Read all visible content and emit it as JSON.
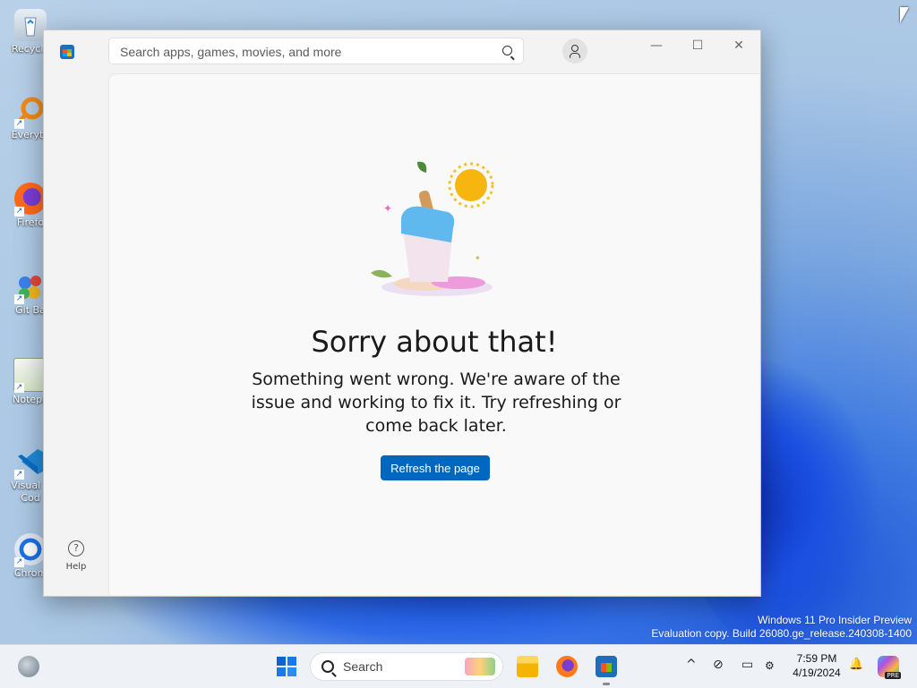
{
  "desktop": {
    "icons": [
      {
        "label": "Recycle",
        "icon": "recycle-bin-icon"
      },
      {
        "label": "Everyth",
        "icon": "everything-search-icon"
      },
      {
        "label": "Firefo",
        "icon": "firefox-icon"
      },
      {
        "label": "Git Ba",
        "icon": "git-bash-icon"
      },
      {
        "label": "Notepa",
        "icon": "notepad-plus-plus-icon"
      },
      {
        "label": "Visual S\nCod",
        "icon": "vscode-icon"
      },
      {
        "label": "Chrom",
        "icon": "chrome-icon"
      }
    ],
    "watermark": {
      "line1": "Windows 11 Pro Insider Preview",
      "line2": "Evaluation copy. Build 26080.ge_release.240308-1400"
    }
  },
  "store_window": {
    "search": {
      "placeholder": "Search apps, games, movies, and more"
    },
    "controls": {
      "minimize": "—",
      "maximize": "☐",
      "close": "✕"
    },
    "sidebar": {
      "help_label": "Help"
    },
    "error": {
      "title": "Sorry about that!",
      "message": "Something went wrong. We're aware of the issue and working to fix it. Try refreshing or come back later.",
      "button": "Refresh the page"
    }
  },
  "taskbar": {
    "search_label": "Search",
    "clock": {
      "time": "7:59 PM",
      "date": "4/19/2024"
    },
    "copilot_badge": "PRE",
    "tray": {
      "chevron": "^",
      "network": "⊘",
      "display": "▭",
      "bell": "🔔"
    }
  }
}
